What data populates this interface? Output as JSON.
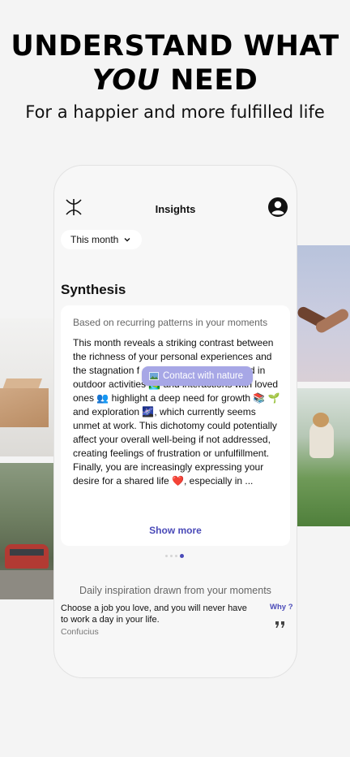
{
  "hero": {
    "line1": "UNDERSTAND WHAT",
    "line2_emphasis": "YOU",
    "line2_rest": " NEED",
    "subline": "For a happier and more fulfilled life"
  },
  "screen": {
    "title": "Insights",
    "month_select": "This month",
    "section_title": "Synthesis",
    "card": {
      "subtitle": "Based on recurring patterns in your moments",
      "body": "This month reveals a striking contrast between the richness of your personal experiences and the stagnation f            environment. Th                            ion found in outdoor activities 🏞️ and interactions with loved ones 👥 highlight a deep need for growth 📚 🌱 and exploration 🌌, which currently seems unmet at work. This dichotomy could potentially affect your overall well-being if not addressed, creating feelings of frustration or unfulfillment. Finally, you are increasingly expressing your desire for a shared life ❤️, especially in ...",
      "tooltip": "Contact with nature",
      "show_more": "Show more"
    },
    "pagination": {
      "count": 4,
      "active": 3
    },
    "daily": {
      "title": "Daily inspiration drawn from your moments",
      "quote": "Choose a job you love, and you will never have to work a day in your life.",
      "author": "Confucius",
      "why": "Why ?"
    }
  },
  "colors": {
    "accent": "#4a4ab8",
    "tooltip": "#a7a7e6",
    "background": "#f4f4f4",
    "card": "#ffffff"
  },
  "icons": [
    "logo-icon",
    "profile-icon",
    "chevron-down-icon",
    "picture-icon",
    "quote-icon"
  ]
}
